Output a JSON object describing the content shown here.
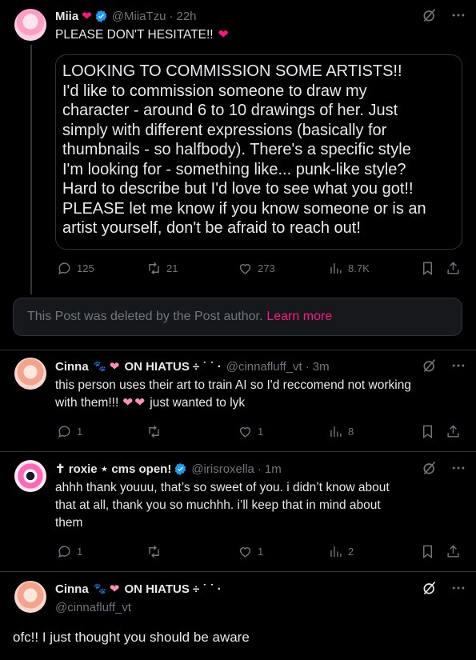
{
  "post1": {
    "name": "Miia",
    "handle": "@MiiaTzu",
    "time": "22h",
    "text": "PLEASE DON'T HESITATE!!",
    "quote_lines": [
      "LOOKING TO COMMISSION SOME ARTISTS!!",
      "I'd like to commission someone to draw my",
      "character - around 6 to 10 drawings of her. Just",
      "simply with different expressions (basically for",
      "thumbnails - so halfbody). There's a specific style",
      "I'm looking for - something like... punk-like style?",
      "Hard to describe but I'd love to see what you got!!",
      "PLEASE let me know if you know someone or is an",
      "artist yourself, don't be afraid to reach out!"
    ],
    "replies": "125",
    "reposts": "21",
    "likes": "273",
    "views": "8.7K"
  },
  "deleted_notice": {
    "text": "This Post was deleted by the Post author.",
    "link": "Learn more"
  },
  "post2": {
    "name": "Cinna",
    "suffix": "ON HIATUS ÷ ˙ ˙ ·",
    "handle": "@cinnafluff_vt",
    "time": "3m",
    "line1": "this person uses their art to train AI so I'd reccomend not working",
    "line2a": "with them!!!",
    "line2b": "just wanted to lyk",
    "replies": "1",
    "likes": "1",
    "views": "8"
  },
  "post3": {
    "name": "✝ roxie ⋆ cms open!",
    "handle": "@irisroxella",
    "time": "1m",
    "lines": [
      "ahhh thank youuu, that’s so sweet of you. i didn’t know about",
      "that at all, thank you so muchhh. i’ll keep that in mind about",
      "them"
    ],
    "replies": "1",
    "likes": "1",
    "views": "2"
  },
  "post4": {
    "name": "Cinna",
    "suffix": "ON HIATUS ÷ ˙ ˙ ·",
    "handle": "@cinnafluff_vt",
    "text": "ofc!! I just thought you should be aware"
  },
  "colors": {
    "background": "#000000",
    "text": "#e7e9ea",
    "muted": "#71767b",
    "accent_pink": "#f91880",
    "verified_blue": "#1d9bf0"
  },
  "icons": [
    "grok-icon",
    "more-icon",
    "reply-icon",
    "repost-icon",
    "like-icon",
    "views-icon",
    "bookmark-icon",
    "share-icon",
    "verified-icon"
  ]
}
